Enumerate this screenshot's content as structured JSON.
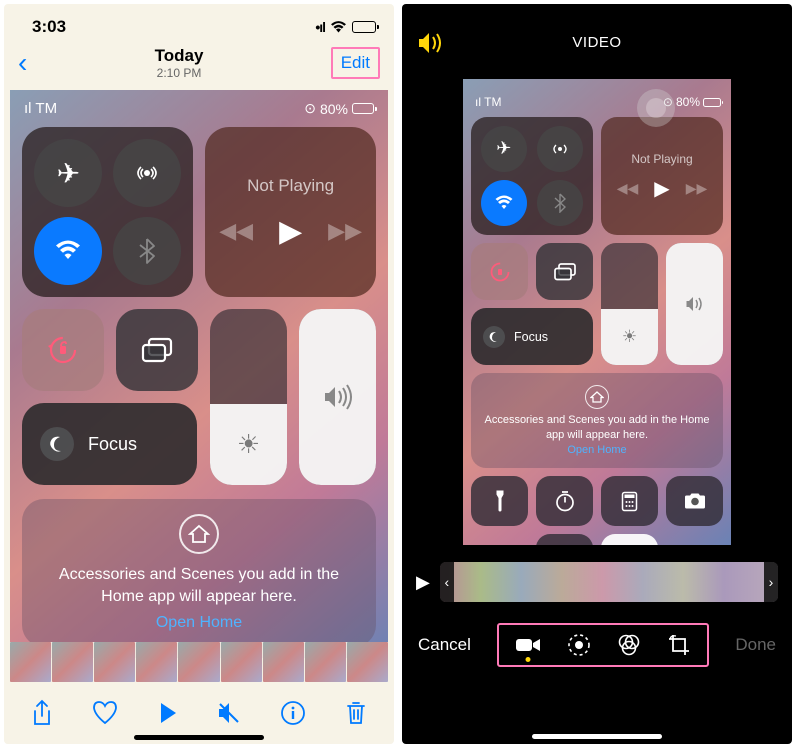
{
  "left": {
    "statusbar": {
      "time": "3:03"
    },
    "nav": {
      "title": "Today",
      "subtitle": "2:10 PM",
      "edit": "Edit"
    },
    "cc": {
      "carrier": "TM",
      "battery": "80%",
      "notPlaying": "Not Playing",
      "focus": "Focus",
      "homeHub": "Accessories and Scenes you add in the Home app will appear here.",
      "openHome": "Open Home"
    }
  },
  "right": {
    "header": "VIDEO",
    "cc": {
      "carrier": "TM",
      "battery": "80%",
      "notPlaying": "Not Playing",
      "focus": "Focus",
      "homeHub": "Accessories and Scenes you add in the Home app will appear here.",
      "openHome": "Open Home"
    },
    "footer": {
      "cancel": "Cancel",
      "done": "Done"
    }
  }
}
